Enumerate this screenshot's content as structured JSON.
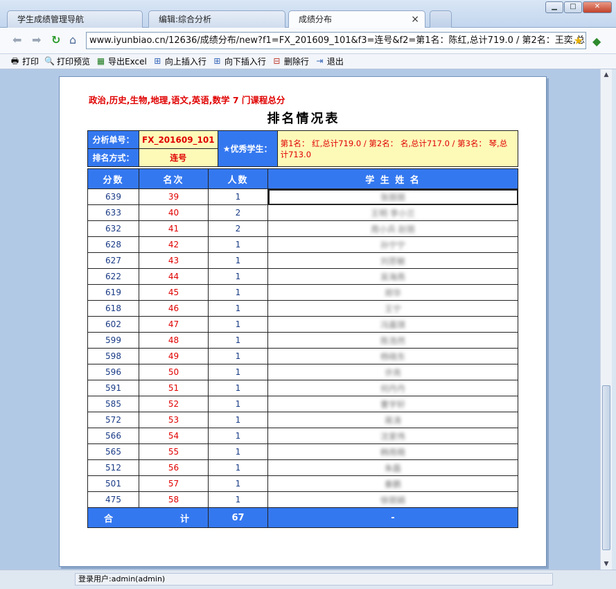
{
  "tabs": [
    {
      "label": "学生成绩管理导航"
    },
    {
      "label": "编辑:综合分析"
    },
    {
      "label": "成绩分布"
    }
  ],
  "window": {
    "close_tab_symbol": "×"
  },
  "navigation": {
    "url": "www.iyunbiao.cn/12636/成绩分布/new?f1=FX_201609_101&f3=连号&f2=第1名：陈红,总计719.0 / 第2名：王奕,总"
  },
  "toolbar": {
    "items": [
      {
        "label": "打印",
        "icon": "printer-icon"
      },
      {
        "label": "打印预览",
        "icon": "print-preview-icon"
      },
      {
        "label": "导出Excel",
        "icon": "excel-icon"
      },
      {
        "label": "向上插入行",
        "icon": "insert-row-above-icon"
      },
      {
        "label": "向下插入行",
        "icon": "insert-row-below-icon"
      },
      {
        "label": "删除行",
        "icon": "delete-row-icon"
      },
      {
        "label": "退出",
        "icon": "exit-icon"
      }
    ]
  },
  "report": {
    "subjects_line": "政治,历史,生物,地理,语文,英语,数学 7  门课程总分",
    "title": "排名情况表",
    "analysis_no_label": "分析单号：",
    "analysis_no_value": "FX_201609_101",
    "rank_mode_label": "排名方式：",
    "rank_mode_value": "连号",
    "top_students_label": "★优秀学生：",
    "top_students_value": "第1名：    红,总计719.0 / 第2名：    名,总计717.0 / 第3名：    琴,总计713.0"
  },
  "table": {
    "headers": {
      "score": "分数",
      "rank": "名次",
      "count": "人数",
      "names": "学 生 姓 名"
    },
    "rows": [
      {
        "score": "639",
        "rank": "39",
        "count": "1",
        "names": "张丽丽"
      },
      {
        "score": "633",
        "rank": "40",
        "count": "2",
        "names": "王明  李小兰"
      },
      {
        "score": "632",
        "rank": "41",
        "count": "2",
        "names": "周小兵  赵丽"
      },
      {
        "score": "628",
        "rank": "42",
        "count": "1",
        "names": "孙宁宁"
      },
      {
        "score": "627",
        "rank": "43",
        "count": "1",
        "names": "刘思敏"
      },
      {
        "score": "622",
        "rank": "44",
        "count": "1",
        "names": "吴海燕"
      },
      {
        "score": "619",
        "rank": "45",
        "count": "1",
        "names": "郑华"
      },
      {
        "score": "618",
        "rank": "46",
        "count": "1",
        "names": "王宁"
      },
      {
        "score": "602",
        "rank": "47",
        "count": "1",
        "names": "冯嘉琪"
      },
      {
        "score": "599",
        "rank": "48",
        "count": "1",
        "names": "陈浩然"
      },
      {
        "score": "598",
        "rank": "49",
        "count": "1",
        "names": "杨晓东"
      },
      {
        "score": "596",
        "rank": "50",
        "count": "1",
        "names": "许亮"
      },
      {
        "score": "591",
        "rank": "51",
        "count": "1",
        "names": "何丹丹"
      },
      {
        "score": "585",
        "rank": "52",
        "count": "1",
        "names": "曹宇轩"
      },
      {
        "score": "572",
        "rank": "53",
        "count": "1",
        "names": "蒋涛"
      },
      {
        "score": "566",
        "rank": "54",
        "count": "1",
        "names": "沈家伟"
      },
      {
        "score": "565",
        "rank": "55",
        "count": "1",
        "names": "韩雨萌"
      },
      {
        "score": "512",
        "rank": "56",
        "count": "1",
        "names": "朱磊"
      },
      {
        "score": "501",
        "rank": "57",
        "count": "1",
        "names": "秦鹏"
      },
      {
        "score": "475",
        "rank": "58",
        "count": "1",
        "names": "徐丽娟"
      }
    ],
    "footer": {
      "label_left": "合",
      "label_right": "计",
      "total": "67",
      "names": "-"
    }
  },
  "status": {
    "user_text": "登录用户:admin(admin)"
  }
}
